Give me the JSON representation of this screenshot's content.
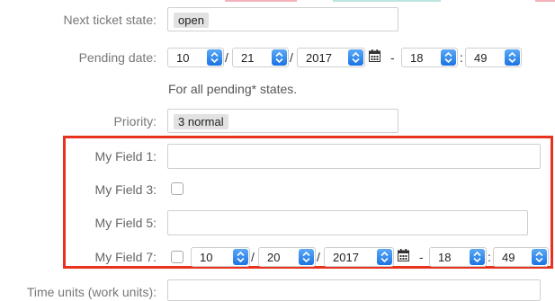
{
  "colors": {
    "highlight_frame": "#e8321e",
    "spinner": "#1b74e4",
    "top_strip": [
      "#f3b3bc",
      "#bfe3de",
      "#f3b3bc"
    ]
  },
  "form": {
    "next_state": {
      "label": "Next ticket state:",
      "value": "open"
    },
    "pending_date": {
      "label": "Pending date:",
      "month": "10",
      "day": "21",
      "year": "2017",
      "hour": "18",
      "minute": "49",
      "date_sep": "/",
      "time_sep": "-",
      "colon": ":",
      "hint": "For all pending* states.",
      "calendar_icon": "calendar-icon"
    },
    "priority": {
      "label": "Priority:",
      "value": "3 normal"
    },
    "field1": {
      "label": "My Field 1:",
      "value": ""
    },
    "field3": {
      "label": "My Field 3:",
      "checked": false
    },
    "field5": {
      "label": "My Field 5:",
      "value": ""
    },
    "field7": {
      "label": "My Field 7:",
      "checked": false,
      "month": "10",
      "day": "20",
      "year": "2017",
      "hour": "18",
      "minute": "49",
      "date_sep": "/",
      "time_sep": "-",
      "colon": ":",
      "calendar_icon": "calendar-icon"
    },
    "time_units": {
      "label": "Time units (work units):",
      "value": ""
    }
  }
}
